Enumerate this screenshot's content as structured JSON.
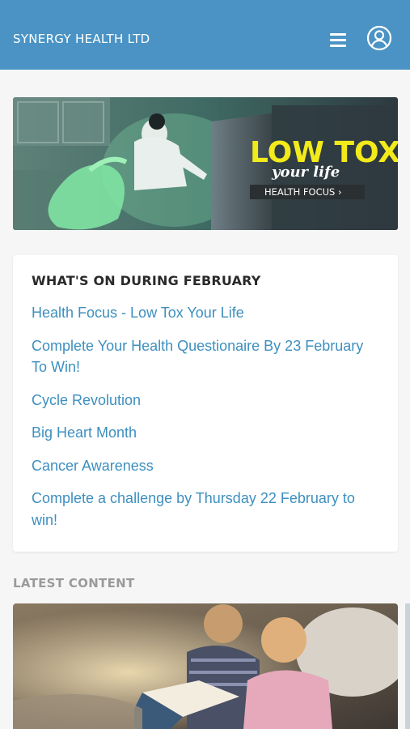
{
  "header": {
    "brand": "SYNERGY HEALTH LTD",
    "menu_icon": "hamburger-menu-icon",
    "account_icon": "user-circle-icon",
    "background": "#4a93c4"
  },
  "banner": {
    "title_line1": "LOW TOX",
    "title_line2": "your life",
    "cta": "HEALTH FOCUS ›"
  },
  "whats_on": {
    "heading": "WHAT'S ON DURING FEBRUARY",
    "items": [
      "Health Focus - Low Tox Your Life",
      "Complete Your Health Questionaire By 23 February To Win!",
      "Cycle Revolution",
      "Big Heart Month",
      "Cancer Awareness",
      "Complete a challenge by Thursday 22 February to win!"
    ]
  },
  "latest": {
    "heading": "LATEST CONTENT"
  },
  "colors": {
    "link": "#3d8fbf",
    "page_bg": "#f6f6f6",
    "banner_title": "#f2ea1a"
  }
}
